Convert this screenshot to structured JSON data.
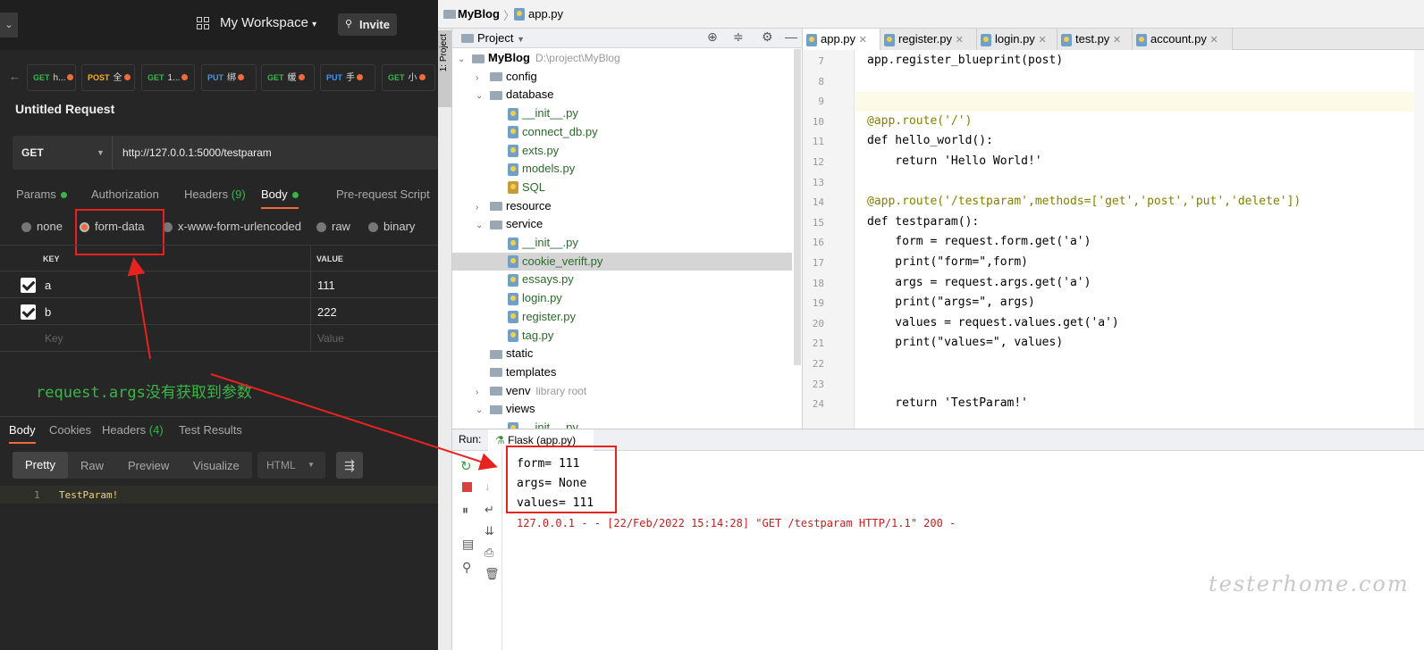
{
  "postman": {
    "workspace": "My Workspace",
    "invite": "Invite",
    "tabs": [
      {
        "method": "GET",
        "label": "h..."
      },
      {
        "method": "POST",
        "label": "全"
      },
      {
        "method": "GET",
        "label": "1..."
      },
      {
        "method": "PUT",
        "label": "绑"
      },
      {
        "method": "GET",
        "label": "缓"
      },
      {
        "method": "PUT",
        "label": "手"
      },
      {
        "method": "GET",
        "label": "小"
      }
    ],
    "request_title": "Untitled Request",
    "method": "GET",
    "url": "http://127.0.0.1:5000/testparam",
    "req_tabs": {
      "params": "Params",
      "authorization": "Authorization",
      "headers": "Headers",
      "headers_count": "(9)",
      "body": "Body",
      "prerequest": "Pre-request Script"
    },
    "body_types": {
      "none": "none",
      "formdata": "form-data",
      "urlencoded": "x-www-form-urlencoded",
      "raw": "raw",
      "binary": "binary"
    },
    "table": {
      "key_header": "KEY",
      "value_header": "VALUE",
      "rows": [
        {
          "key": "a",
          "value": "111"
        },
        {
          "key": "b",
          "value": "222"
        }
      ],
      "key_placeholder": "Key",
      "value_placeholder": "Value"
    },
    "annotation": "request.args没有获取到参数",
    "resp_tabs": {
      "body": "Body",
      "cookies": "Cookies",
      "headers": "Headers",
      "headers_count": "(4)",
      "tests": "Test Results"
    },
    "view_modes": {
      "pretty": "Pretty",
      "raw": "Raw",
      "preview": "Preview",
      "visualize": "Visualize",
      "format": "HTML"
    },
    "response": {
      "line_no": "1",
      "text": "TestParam!"
    }
  },
  "ide": {
    "breadcrumb": {
      "project": "MyBlog",
      "file": "app.py"
    },
    "side_tab": "1: Project",
    "panel_title": "Project",
    "tree": [
      {
        "label": "MyBlog",
        "note": "D:\\project\\MyBlog",
        "type": "root",
        "depth": 0,
        "arrow": "v"
      },
      {
        "label": "config",
        "type": "folder",
        "depth": 1,
        "arrow": ">"
      },
      {
        "label": "database",
        "type": "folder",
        "depth": 1,
        "arrow": "v"
      },
      {
        "label": "__init__.py",
        "type": "py",
        "depth": 2,
        "arrow": ""
      },
      {
        "label": "connect_db.py",
        "type": "py",
        "depth": 2,
        "arrow": ""
      },
      {
        "label": "exts.py",
        "type": "py",
        "depth": 2,
        "arrow": ""
      },
      {
        "label": "models.py",
        "type": "py",
        "depth": 2,
        "arrow": ""
      },
      {
        "label": "SQL",
        "type": "sql",
        "depth": 2,
        "arrow": ""
      },
      {
        "label": "resource",
        "type": "folder",
        "depth": 1,
        "arrow": ">"
      },
      {
        "label": "service",
        "type": "folder",
        "depth": 1,
        "arrow": "v"
      },
      {
        "label": "__init__.py",
        "type": "py",
        "depth": 2,
        "arrow": ""
      },
      {
        "label": "cookie_verift.py",
        "type": "py",
        "depth": 2,
        "arrow": "",
        "selected": true
      },
      {
        "label": "essays.py",
        "type": "py",
        "depth": 2,
        "arrow": ""
      },
      {
        "label": "login.py",
        "type": "py",
        "depth": 2,
        "arrow": ""
      },
      {
        "label": "register.py",
        "type": "py",
        "depth": 2,
        "arrow": ""
      },
      {
        "label": "tag.py",
        "type": "py",
        "depth": 2,
        "arrow": ""
      },
      {
        "label": "static",
        "type": "folder",
        "depth": 1,
        "arrow": ""
      },
      {
        "label": "templates",
        "type": "folder",
        "depth": 1,
        "arrow": ""
      },
      {
        "label": "venv",
        "note": "library root",
        "type": "folder",
        "depth": 1,
        "arrow": ">"
      },
      {
        "label": "views",
        "type": "folder",
        "depth": 1,
        "arrow": "v"
      },
      {
        "label": "__init__.py",
        "type": "py",
        "depth": 2,
        "arrow": ""
      }
    ],
    "editor_tabs": [
      "app.py",
      "register.py",
      "login.py",
      "test.py",
      "account.py"
    ],
    "code": [
      {
        "n": "7",
        "t": "app.register_blueprint(post)"
      },
      {
        "n": "8",
        "t": ""
      },
      {
        "n": "9",
        "t": ""
      },
      {
        "n": "10",
        "t": "@app.route('/')"
      },
      {
        "n": "11",
        "t": "def hello_world():"
      },
      {
        "n": "12",
        "t": "    return 'Hello World!'"
      },
      {
        "n": "13",
        "t": ""
      },
      {
        "n": "14",
        "t": "@app.route('/testparam',methods=['get','post','put','delete'])"
      },
      {
        "n": "15",
        "t": "def testparam():"
      },
      {
        "n": "16",
        "t": "    form = request.form.get('a')"
      },
      {
        "n": "17",
        "t": "    print(\"form=\",form)"
      },
      {
        "n": "18",
        "t": "    args = request.args.get('a')"
      },
      {
        "n": "19",
        "t": "    print(\"args=\", args)"
      },
      {
        "n": "20",
        "t": "    values = request.values.get('a')"
      },
      {
        "n": "21",
        "t": "    print(\"values=\", values)"
      },
      {
        "n": "22",
        "t": ""
      },
      {
        "n": "23",
        "t": ""
      },
      {
        "n": "24",
        "t": "    return 'TestParam!'"
      }
    ],
    "run": {
      "label": "Run:",
      "config": "Flask (app.py)",
      "lines": [
        "form= 111",
        "args= None",
        "values= 111"
      ],
      "log": "127.0.0.1 - - [22/Feb/2022 15:14:28] \"GET /testparam HTTP/1.1\" 200 -"
    },
    "watermark": "testerhome.com"
  }
}
